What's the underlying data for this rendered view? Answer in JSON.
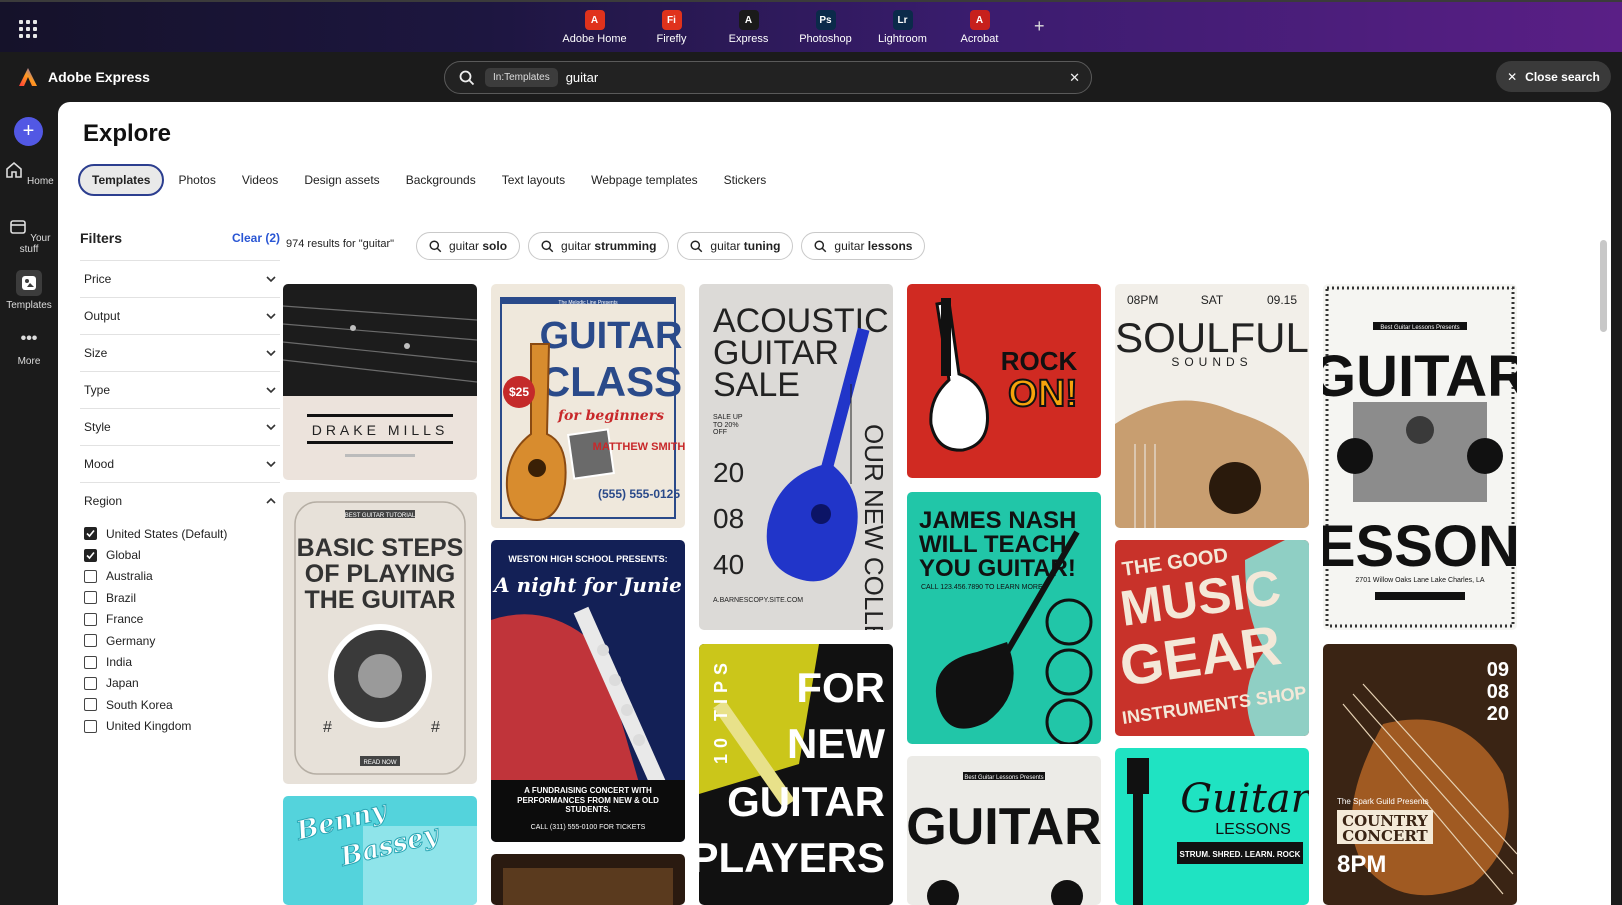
{
  "appbar": {
    "apps": [
      {
        "label": "Adobe Home",
        "icon": "adobe-logo-icon",
        "color": "#e0321c",
        "glyph": "A"
      },
      {
        "label": "Firefly",
        "icon": "firefly-icon",
        "color": "#e0321c",
        "glyph": "Fi"
      },
      {
        "label": "Express",
        "icon": "express-icon",
        "color": "#1a1a1a",
        "glyph": "A",
        "active": true
      },
      {
        "label": "Photoshop",
        "icon": "photoshop-icon",
        "color": "#0b2a4a",
        "glyph": "Ps"
      },
      {
        "label": "Lightroom",
        "icon": "lightroom-icon",
        "color": "#0b2a4a",
        "glyph": "Lr"
      },
      {
        "label": "Acrobat",
        "icon": "acrobat-icon",
        "color": "#c7201c",
        "glyph": "A"
      }
    ]
  },
  "header": {
    "brand": "Adobe Express",
    "search_scope": "In:Templates",
    "search_value": "guitar",
    "close_search": "Close search"
  },
  "rail": {
    "items": [
      {
        "label": "Home"
      },
      {
        "label": "Your stuff"
      },
      {
        "label": "Templates"
      },
      {
        "label": "More"
      }
    ]
  },
  "main": {
    "title": "Explore",
    "tabs": [
      "Templates",
      "Photos",
      "Videos",
      "Design assets",
      "Backgrounds",
      "Text layouts",
      "Webpage templates",
      "Stickers"
    ],
    "filters": {
      "title": "Filters",
      "clear": "Clear (2)",
      "groups": [
        "Price",
        "Output",
        "Size",
        "Type",
        "Style",
        "Mood",
        "Region"
      ],
      "regions": [
        {
          "label": "United States (Default)",
          "checked": true
        },
        {
          "label": "Global",
          "checked": true
        },
        {
          "label": "Australia",
          "checked": false
        },
        {
          "label": "Brazil",
          "checked": false
        },
        {
          "label": "France",
          "checked": false
        },
        {
          "label": "Germany",
          "checked": false
        },
        {
          "label": "India",
          "checked": false
        },
        {
          "label": "Japan",
          "checked": false
        },
        {
          "label": "South Korea",
          "checked": false
        },
        {
          "label": "United Kingdom",
          "checked": false
        }
      ]
    },
    "results_text": "974 results for \"guitar\"",
    "suggestions": [
      {
        "prefix": "guitar ",
        "bold": "solo"
      },
      {
        "prefix": "guitar ",
        "bold": "strumming"
      },
      {
        "prefix": "guitar ",
        "bold": "tuning"
      },
      {
        "prefix": "guitar ",
        "bold": "lessons"
      }
    ]
  },
  "cards": {
    "drake": {
      "name": "DRAKE MILLS"
    },
    "guitar_class": {
      "top": "The Melodic Line Presents",
      "l1": "GUITAR",
      "l2": "CLASS",
      "l3": "for beginners",
      "price": "$25",
      "teacher": "MATTHEW SMITH",
      "phone": "(555) 555-0125"
    },
    "acoustic": {
      "l1": "ACOUSTIC",
      "l2": "GUITAR",
      "l3": "SALE",
      "sale": "SALE UP TO 20% OFF",
      "d1": "20",
      "d2": "08",
      "d3": "40",
      "side": "OUR NEW COLLECTION",
      "site": "A.BARNESCOPY.SITE.COM"
    },
    "rock": {
      "l1": "ROCK",
      "l2": "ON!"
    },
    "soulful": {
      "time": "08PM",
      "day": "SAT",
      "date": "09.15",
      "l1": "SOULFUL",
      "l2": "SOUNDS"
    },
    "lessons": {
      "top": "Best Guitar Lessons Presents",
      "l1": "GUITAR",
      "l2": "LESSONS",
      "addr": "2701 Willow Oaks Lane Lake Charles, LA"
    },
    "basic": {
      "top": "BEST GUITAR TUTORIAL",
      "l1": "BASIC STEPS",
      "l2": "OF PLAYING",
      "l3": "THE GUITAR",
      "btn": "READ NOW"
    },
    "junie": {
      "top": "WESTON HIGH SCHOOL PRESENTS:",
      "title": "A night for Junie",
      "sub": "A FUNDRAISING CONCERT WITH PERFORMANCES FROM NEW & OLD STUDENTS.",
      "call": "CALL (311) 555-0100 FOR TICKETS"
    },
    "james": {
      "l1": "JAMES NASH",
      "l2": "WILL TEACH",
      "l3": "YOU GUITAR!",
      "call": "CALL 123.456.7890 TO LEARN MORE"
    },
    "gear": {
      "l1": "THE GOOD",
      "l2": "MUSIC",
      "l3": "GEAR",
      "l4": "INSTRUMENTS SHOP"
    },
    "tips": {
      "side": "10 TIPS",
      "l1": "FOR",
      "l2": "NEW",
      "l3": "GUITAR",
      "l4": "PLAYERS"
    },
    "guitar2": {
      "top": "Best Guitar Lessons Presents",
      "l1": "GUITAR"
    },
    "teal_lessons": {
      "l1": "Guitar",
      "l2": "LESSONS",
      "l3": "STRUM. SHRED. LEARN. ROCK"
    },
    "country": {
      "date1": "09",
      "date2": "08",
      "date3": "20",
      "top": "The Spark Guild Presents",
      "l1": "COUNTRY",
      "l2": "CONCERT",
      "time": "8PM"
    },
    "benny": {
      "l1": "Benny",
      "l2": "Bassey"
    }
  }
}
